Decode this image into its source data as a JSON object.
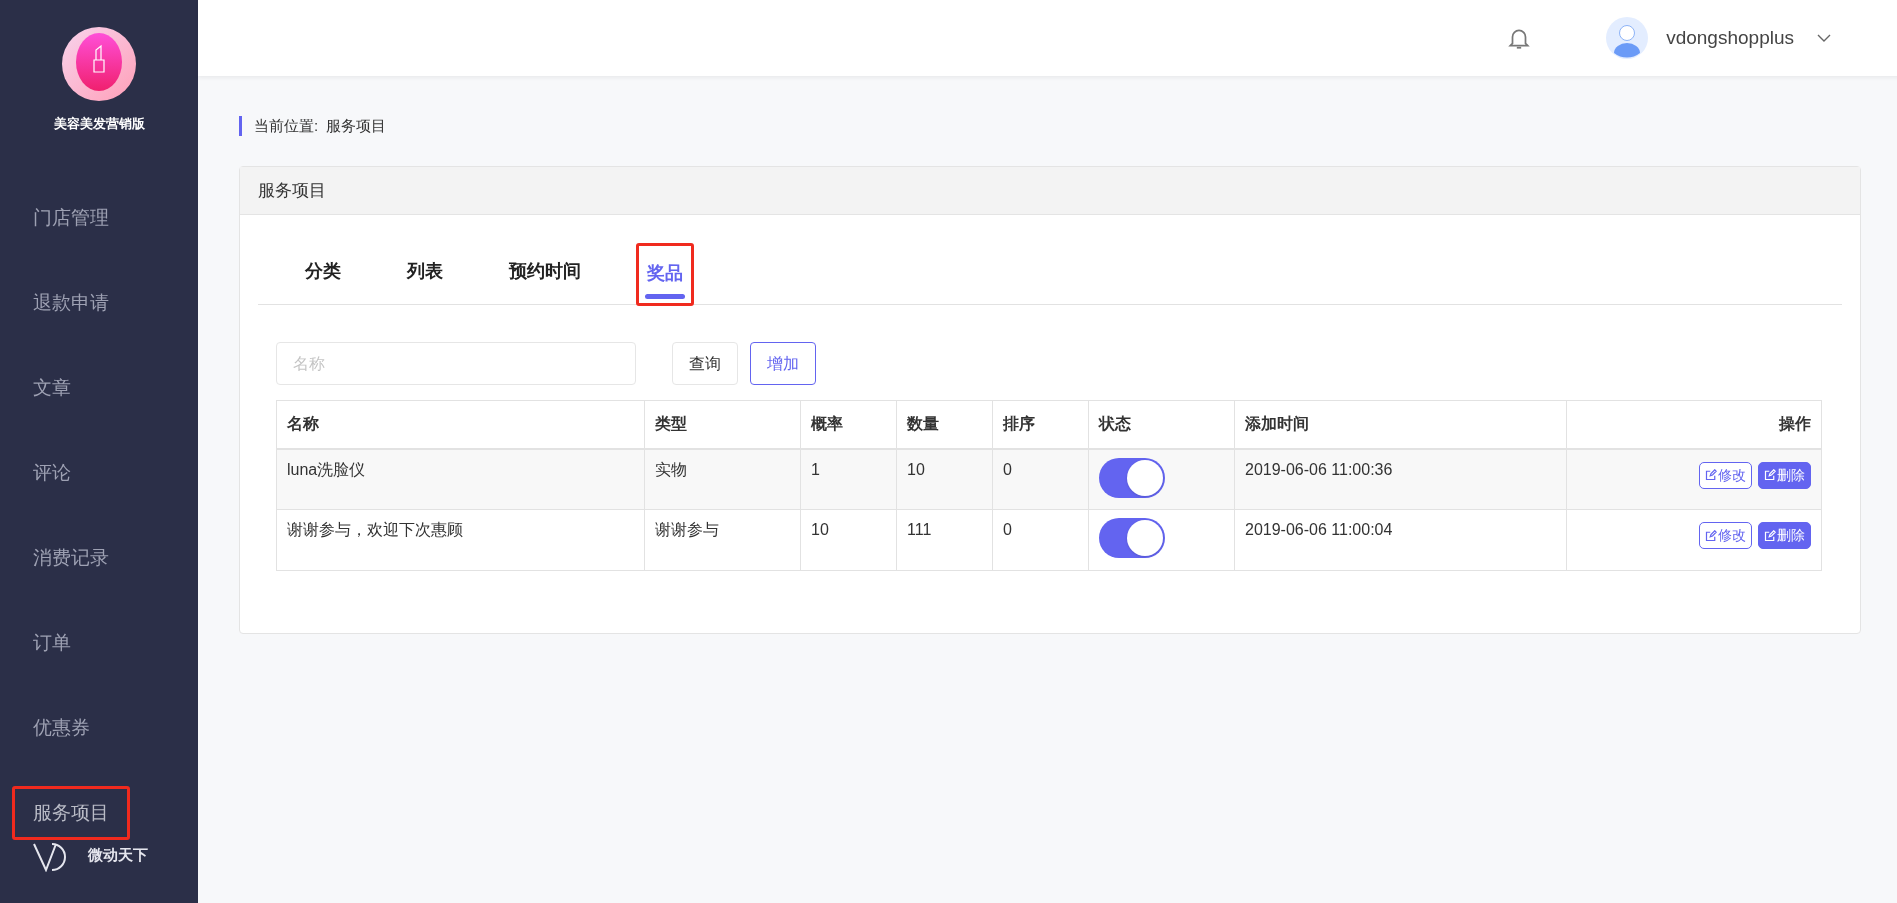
{
  "sidebar": {
    "brand": "美容美发营销版",
    "items": [
      {
        "label": "门店管理",
        "selected": false,
        "highlighted": false
      },
      {
        "label": "退款申请",
        "selected": false,
        "highlighted": false
      },
      {
        "label": "文章",
        "selected": false,
        "highlighted": false
      },
      {
        "label": "评论",
        "selected": false,
        "highlighted": false
      },
      {
        "label": "消费记录",
        "selected": false,
        "highlighted": false
      },
      {
        "label": "订单",
        "selected": false,
        "highlighted": false
      },
      {
        "label": "优惠券",
        "selected": false,
        "highlighted": false
      },
      {
        "label": "服务项目",
        "selected": true,
        "highlighted": true
      }
    ],
    "footer": "微动天下"
  },
  "header": {
    "username": "vdongshopplus"
  },
  "breadcrumb": {
    "label": "当前位置:",
    "current": "服务项目"
  },
  "panel": {
    "title": "服务项目",
    "tabs": [
      {
        "label": "分类",
        "selected": false,
        "highlighted": false
      },
      {
        "label": "列表",
        "selected": false,
        "highlighted": false
      },
      {
        "label": "预约时间",
        "selected": false,
        "highlighted": false
      },
      {
        "label": "奖品",
        "selected": true,
        "highlighted": true
      }
    ],
    "search": {
      "placeholder": "名称"
    },
    "buttons": [
      {
        "label": "查询",
        "kind": "plain"
      },
      {
        "label": "增加",
        "kind": "outline"
      }
    ],
    "table": {
      "columns": [
        "名称",
        "类型",
        "概率",
        "数量",
        "排序",
        "状态",
        "添加时间",
        "操作"
      ],
      "rows": [
        {
          "cells": [
            "luna洗脸仪",
            "实物",
            "1",
            "10",
            "0"
          ],
          "on": true,
          "time": "2019-06-06 11:00:36",
          "actions": [
            "修改",
            "删除"
          ]
        },
        {
          "cells": [
            "谢谢参与，欢迎下次惠顾",
            "谢谢参与",
            "10",
            "111",
            "0"
          ],
          "on": true,
          "time": "2019-06-06 11:00:04",
          "actions": [
            "修改",
            "删除"
          ]
        }
      ]
    }
  }
}
